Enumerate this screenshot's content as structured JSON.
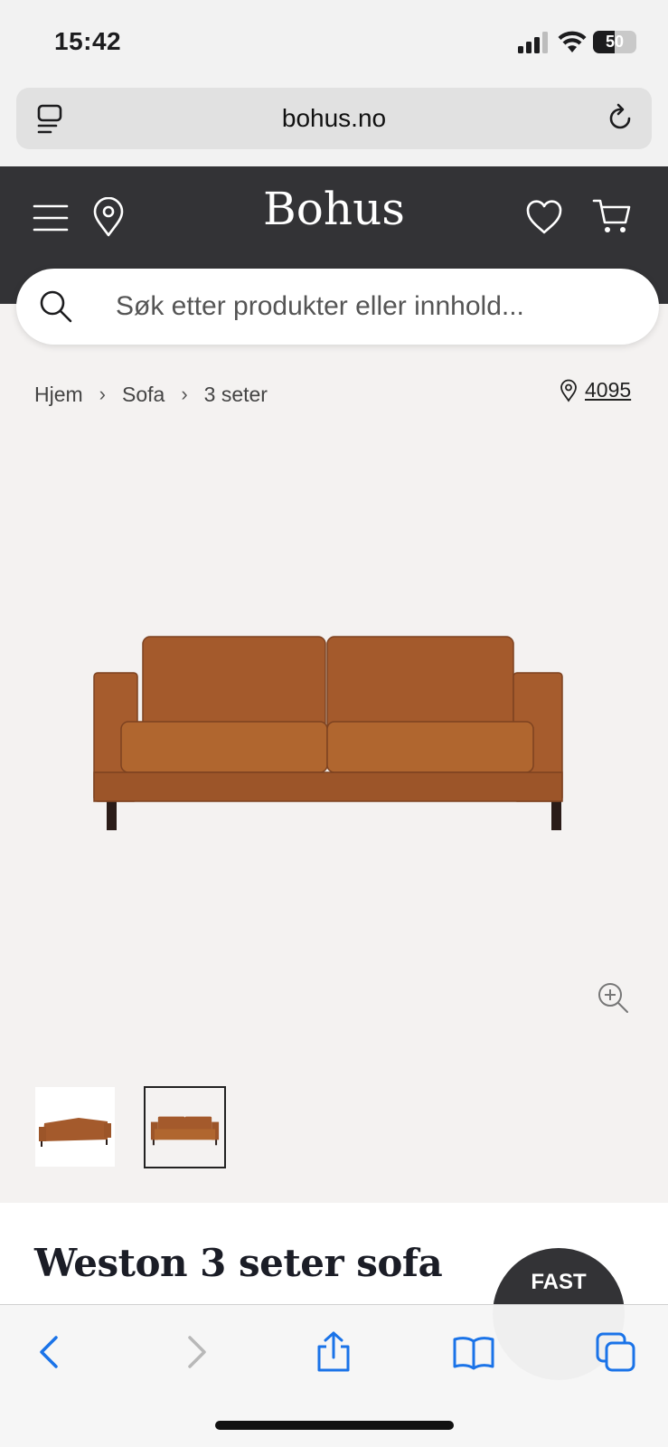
{
  "status_bar": {
    "time": "15:42",
    "battery_level": "50",
    "battery_fraction": 0.5
  },
  "browser": {
    "url": "bohus.no"
  },
  "header": {
    "brand": "Bohus",
    "icons": [
      "menu-icon",
      "location-pin-icon",
      "heart-icon",
      "cart-icon"
    ]
  },
  "search": {
    "placeholder": "Søk etter produkter eller innhold..."
  },
  "breadcrumb": {
    "items": [
      "Hjem",
      "Sofa",
      "3 seter"
    ],
    "store_code": "4095"
  },
  "product": {
    "title": "Weston 3 seter sofa",
    "badge_text": "FAST",
    "color": "#a9602f"
  },
  "toolbar": {
    "icons": [
      "back-icon",
      "forward-icon",
      "share-icon",
      "bookmarks-icon",
      "tabs-icon"
    ]
  },
  "colors": {
    "header_bg": "#333336",
    "accent": "#1a73e8",
    "page_bg": "#f4f2f1"
  }
}
